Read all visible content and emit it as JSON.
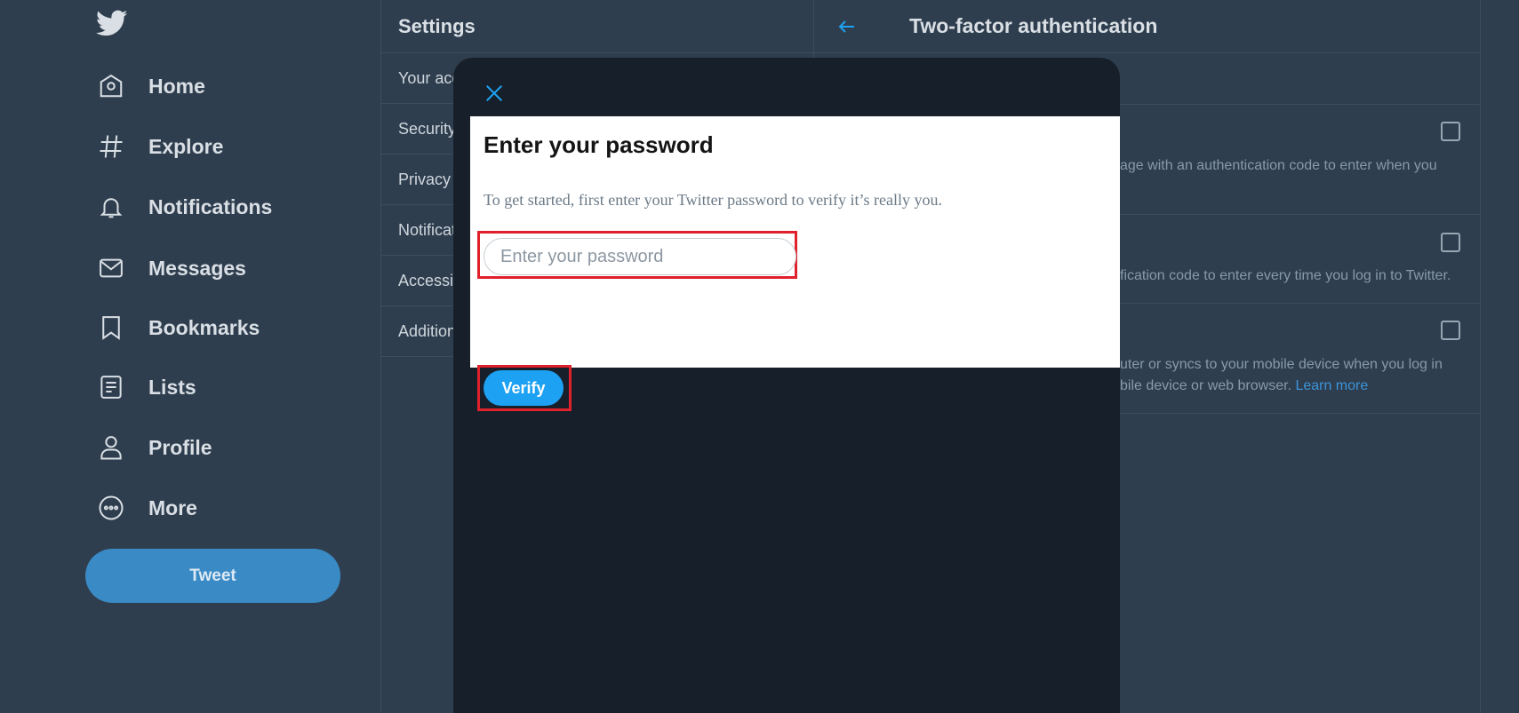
{
  "nav": {
    "logo": "twitter-bird-icon",
    "items": [
      {
        "label": "Home",
        "icon": "home-icon"
      },
      {
        "label": "Explore",
        "icon": "hashtag-icon"
      },
      {
        "label": "Notifications",
        "icon": "bell-icon"
      },
      {
        "label": "Messages",
        "icon": "envelope-icon"
      },
      {
        "label": "Bookmarks",
        "icon": "bookmark-icon"
      },
      {
        "label": "Lists",
        "icon": "list-icon"
      },
      {
        "label": "Profile",
        "icon": "person-icon"
      },
      {
        "label": "More",
        "icon": "more-icon"
      }
    ],
    "tweet_label": "Tweet"
  },
  "settings": {
    "title": "Settings",
    "items": [
      {
        "label": "Your account"
      },
      {
        "label": "Security and account access"
      },
      {
        "label": "Privacy and safety"
      },
      {
        "label": "Notifications"
      },
      {
        "label": "Accessibility, display, and languages"
      },
      {
        "label": "Additional resources"
      }
    ]
  },
  "tfa": {
    "title": "Two-factor authentication",
    "rows": [
      {
        "desc1": "age with an authentication code to enter when you",
        "desc2": ""
      },
      {
        "desc1": "fication code to enter every time you log in to Twitter.",
        "desc2": ""
      },
      {
        "desc1": "uter or syncs to your mobile device when you log in",
        "desc2": "bile device or web browser. ",
        "link": "Learn more"
      }
    ]
  },
  "modal": {
    "heading": "Enter your password",
    "description": "To get started, first enter your Twitter password to verify it’s really you.",
    "password_placeholder": "Enter your password",
    "password_value": "",
    "verify_label": "Verify"
  },
  "colors": {
    "background": "#2f3e4e",
    "modal": "#17202a",
    "accent": "#1da1f2",
    "highlight": "#e0202a"
  }
}
